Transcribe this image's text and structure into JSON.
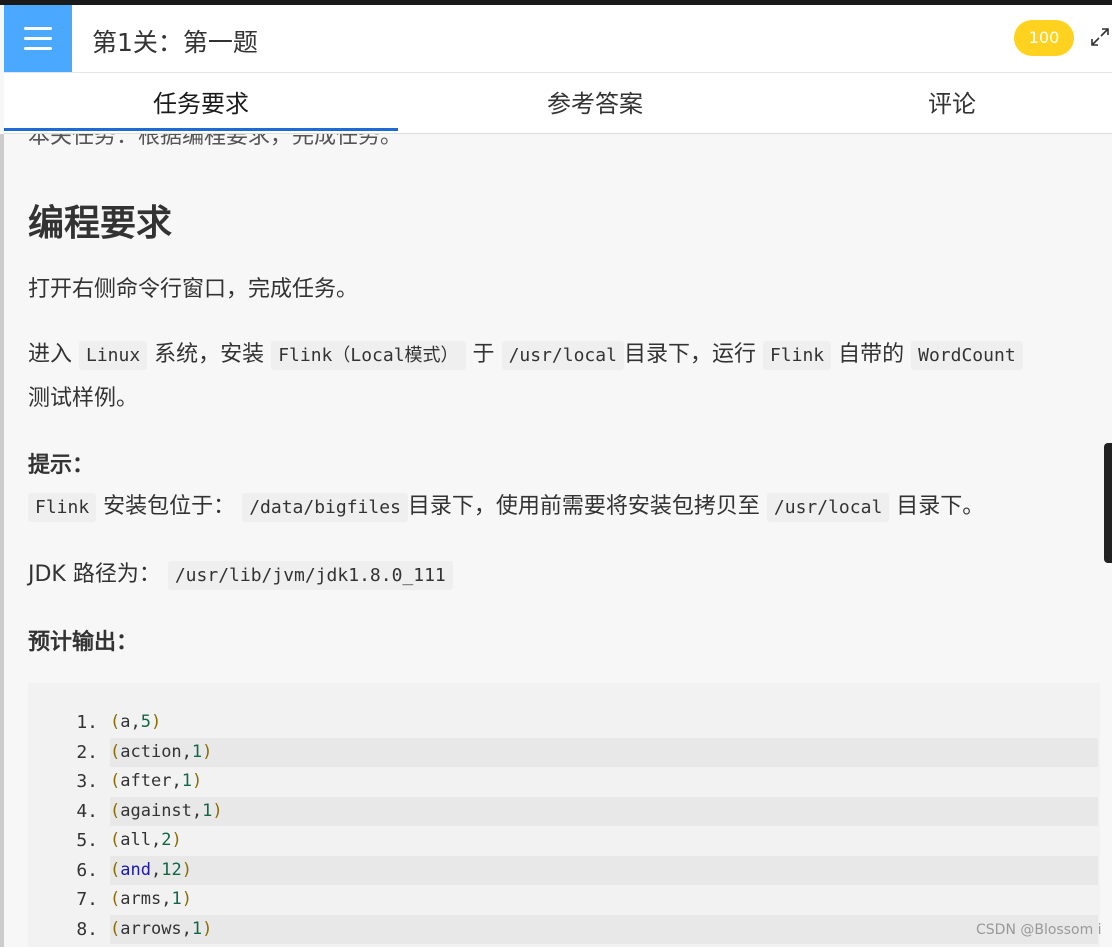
{
  "header": {
    "title": "第1关：第一题",
    "score": "100"
  },
  "tabs": [
    {
      "label": "任务要求"
    },
    {
      "label": "参考答案"
    },
    {
      "label": "评论"
    }
  ],
  "content": {
    "cut_line": "本关任务：根据编程要求，完成任务。",
    "heading": "编程要求",
    "p1": "打开右侧命令行窗口，完成任务。",
    "p2": {
      "t1": "进入 ",
      "c1": "Linux",
      "t2": " 系统，安装 ",
      "c2": "Flink（Local模式）",
      "t3": " 于 ",
      "c3": "/usr/local",
      "t4": "目录下，运行 ",
      "c4": "Flink",
      "t5": " 自带的 ",
      "c5": "WordCount",
      "t6": "测试样例。"
    },
    "hint_label": "提示：",
    "hint": {
      "c1": "Flink",
      "t1": " 安装包位于： ",
      "c2": "/data/bigfiles",
      "t2": "目录下，使用前需要将安装包拷贝至 ",
      "c3": "/usr/local",
      "t3": " 目录下。"
    },
    "jdk": {
      "label": "JDK 路径为： ",
      "path": "/usr/lib/jvm/jdk1.8.0_111"
    },
    "output_label": "预计输出：",
    "output_lines": [
      {
        "n": "1.",
        "word": "a",
        "count": "5"
      },
      {
        "n": "2.",
        "word": "action",
        "count": "1"
      },
      {
        "n": "3.",
        "word": "after",
        "count": "1"
      },
      {
        "n": "4.",
        "word": "against",
        "count": "1"
      },
      {
        "n": "5.",
        "word": "all",
        "count": "2"
      },
      {
        "n": "6.",
        "word": "and",
        "count": "12"
      },
      {
        "n": "7.",
        "word": "arms",
        "count": "1"
      },
      {
        "n": "8.",
        "word": "arrows",
        "count": "1"
      }
    ]
  },
  "watermark": "CSDN @Blossom i",
  "colors": {
    "menu": "#4aa8ff",
    "score": "#ffd21f",
    "tab_active_line": "#1e6bd6"
  },
  "icons": {
    "menu": "hamburger-icon",
    "expand": "expand-icon"
  }
}
